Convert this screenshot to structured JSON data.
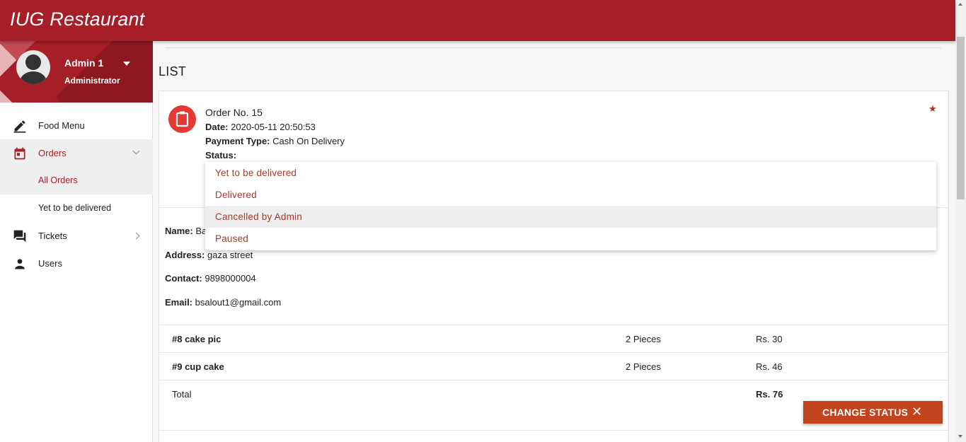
{
  "app": {
    "title": "IUG Restaurant"
  },
  "user": {
    "name": "Admin 1",
    "role": "Administrator"
  },
  "sidebar": {
    "items": [
      {
        "label": "Food Menu",
        "icon": "pencil-icon"
      },
      {
        "label": "Orders",
        "icon": "calendar-icon",
        "expanded": true
      },
      {
        "label": "All Orders",
        "sub": true,
        "active": true
      },
      {
        "label": "Yet to be delivered",
        "sub": true
      },
      {
        "label": "Tickets",
        "icon": "chat-icon"
      },
      {
        "label": "Users",
        "icon": "person-icon"
      }
    ]
  },
  "main": {
    "title": "LIST"
  },
  "order": {
    "title": "Order No. 15",
    "date_label": "Date:",
    "date_value": "2020-05-11 20:50:53",
    "payment_label": "Payment Type:",
    "payment_value": "Cash On Delivery",
    "status_label": "Status:",
    "name_label": "Name:",
    "name_value": "Ba",
    "address_label": "Address:",
    "address_value": "gaza street",
    "contact_label": "Contact:",
    "contact_value": "9898000004",
    "email_label": "Email:",
    "email_value": "bsalout1@gmail.com"
  },
  "items_table": {
    "rows": [
      {
        "name": "#8 cake pic",
        "qty": "2 Pieces",
        "price": "Rs. 30"
      },
      {
        "name": "#9 cup cake",
        "qty": "2 Pieces",
        "price": "Rs. 46"
      }
    ],
    "total_label": "Total",
    "total_value": "Rs. 76"
  },
  "status_dropdown": {
    "options": [
      "Yet to be delivered",
      "Delivered",
      "Cancelled by Admin",
      "Paused"
    ],
    "highlighted": "Cancelled by Admin"
  },
  "buttons": {
    "change_status": "CHANGE STATUS",
    "close_symbol": "✕"
  },
  "colors": {
    "brand": "#a61e27",
    "accent": "#c2441f",
    "order_icon": "#e53935"
  }
}
